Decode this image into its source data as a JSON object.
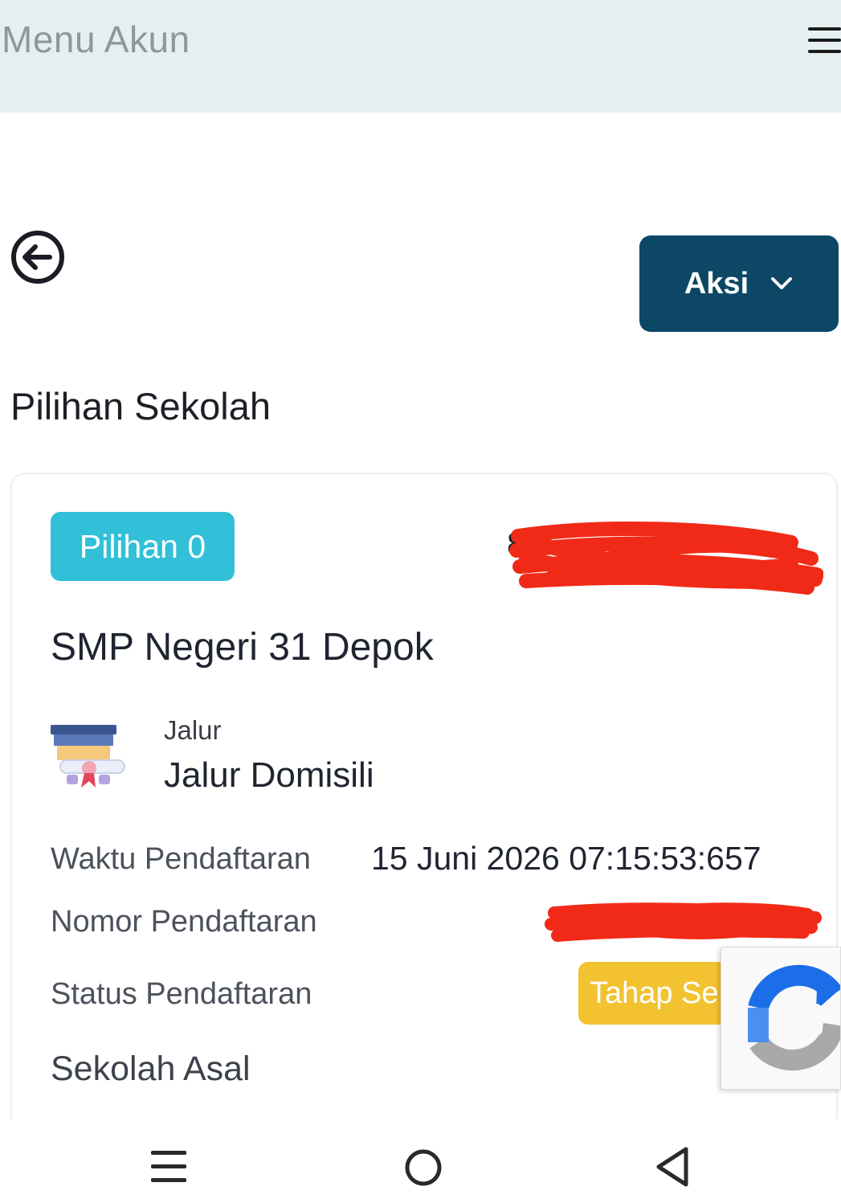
{
  "header": {
    "title": "Menu Akun",
    "menu_icon": "hamburger-menu-icon"
  },
  "toolbar": {
    "back_icon": "arrow-left-circle-icon",
    "aksi_label": "Aksi",
    "aksi_icon": "chevron-down-icon"
  },
  "section": {
    "title": "Pilihan Sekolah"
  },
  "card": {
    "choice_badge": "Pilihan 0",
    "top_code_visible": "8",
    "school_name": "SMP Negeri 31 Depok",
    "jalur": {
      "icon": "graduation-certificate-icon",
      "label": "Jalur",
      "value": "Jalur Domisili"
    },
    "rows": [
      {
        "label": "Waktu Pendaftaran",
        "value": "15 Juni 2026 07:15:53:657"
      },
      {
        "label": "Nomor Pendaftaran",
        "value": ""
      },
      {
        "label": "Status Pendaftaran",
        "value": "Tahap Se"
      }
    ],
    "subsection_title": "Sekolah Asal"
  },
  "colors": {
    "header_bg": "#e6eff0",
    "primary_button": "#0d4766",
    "choice_badge": "#31c0d8",
    "status_badge": "#f2c230",
    "redaction": "#f02a16"
  },
  "overlay": {
    "recaptcha_icon": "recaptcha-icon"
  },
  "system_nav": {
    "recents_icon": "recents-icon",
    "home_icon": "home-icon",
    "back_icon": "back-triangle-icon"
  }
}
